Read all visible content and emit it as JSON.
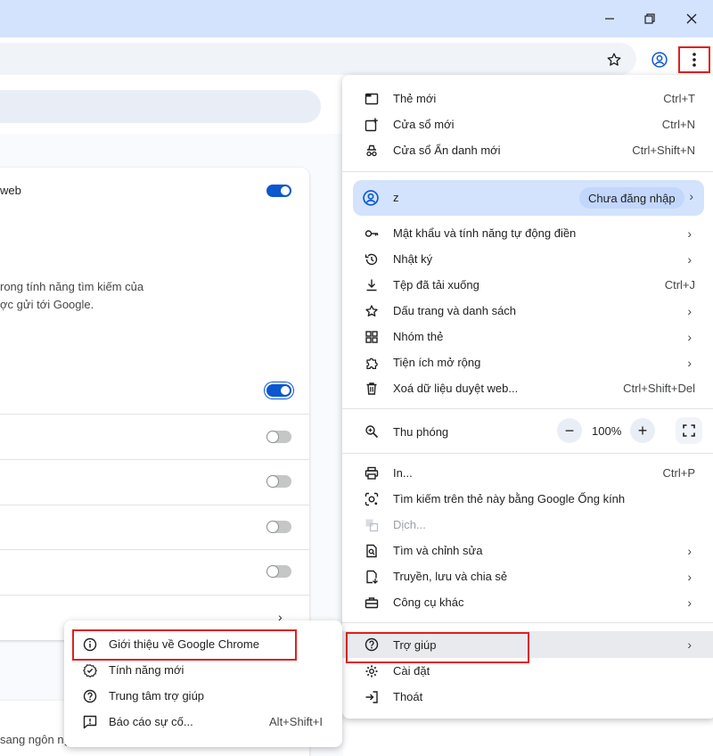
{
  "window": {
    "controls": [
      "minimize-icon",
      "restore-icon",
      "close-icon"
    ]
  },
  "toolbar": {
    "icons": [
      "star-icon",
      "profile-icon",
      "more-vert-icon"
    ]
  },
  "page": {
    "card_rows": [
      {
        "text": "web"
      },
      {
        "text": "rong tính năng tìm kiếm của\nợc gửi tới Google."
      }
    ],
    "toggles": [
      "on",
      "on",
      "off",
      "off",
      "off",
      "off"
    ],
    "bottom_text": "sang ngôn ng"
  },
  "menu": {
    "items_top": [
      {
        "icon": "new-tab-icon",
        "label": "Thẻ mới",
        "shortcut": "Ctrl+T"
      },
      {
        "icon": "new-window-icon",
        "label": "Cửa sổ mới",
        "shortcut": "Ctrl+N"
      },
      {
        "icon": "incognito-icon",
        "label": "Cửa sổ Ẩn danh mới",
        "shortcut": "Ctrl+Shift+N"
      }
    ],
    "profile": {
      "name": "z",
      "status": "Chưa đăng nhập"
    },
    "items_mid": [
      {
        "icon": "key-icon",
        "label": "Mật khẩu và tính năng tự động điền",
        "shortcut": "",
        "submenu": true
      },
      {
        "icon": "history-icon",
        "label": "Nhật ký",
        "shortcut": "",
        "submenu": true
      },
      {
        "icon": "download-icon",
        "label": "Tệp đã tải xuống",
        "shortcut": "Ctrl+J",
        "submenu": false
      },
      {
        "icon": "bookmark-star-icon",
        "label": "Dấu trang và danh sách",
        "shortcut": "",
        "submenu": true
      },
      {
        "icon": "tab-groups-icon",
        "label": "Nhóm thẻ",
        "shortcut": "",
        "submenu": true
      },
      {
        "icon": "extension-icon",
        "label": "Tiện ích mở rộng",
        "shortcut": "",
        "submenu": true
      },
      {
        "icon": "trash-icon",
        "label": "Xoá dữ liệu duyệt web...",
        "shortcut": "Ctrl+Shift+Del",
        "submenu": false
      }
    ],
    "zoom": {
      "label": "Thu phóng",
      "minus": "−",
      "value": "100%",
      "plus": "+"
    },
    "items_tools": [
      {
        "icon": "print-icon",
        "label": "In...",
        "shortcut": "Ctrl+P",
        "submenu": false,
        "disabled": false
      },
      {
        "icon": "lens-icon",
        "label": "Tìm kiếm trên thẻ này bằng Google Ống kính",
        "shortcut": "",
        "submenu": false,
        "disabled": false
      },
      {
        "icon": "translate-icon",
        "label": "Dịch...",
        "shortcut": "",
        "submenu": false,
        "disabled": true
      },
      {
        "icon": "find-edit-icon",
        "label": "Tìm và chỉnh sửa",
        "shortcut": "",
        "submenu": true,
        "disabled": false
      },
      {
        "icon": "cast-save-share-icon",
        "label": "Truyền, lưu và chia sẻ",
        "shortcut": "",
        "submenu": true,
        "disabled": false
      },
      {
        "icon": "toolbox-icon",
        "label": "Công cụ khác",
        "shortcut": "",
        "submenu": true,
        "disabled": false
      }
    ],
    "items_bottom": [
      {
        "icon": "help-icon",
        "label": "Trợ giúp",
        "submenu": true
      },
      {
        "icon": "settings-icon",
        "label": "Cài đặt",
        "submenu": false
      },
      {
        "icon": "exit-icon",
        "label": "Thoát",
        "submenu": false
      }
    ]
  },
  "help_submenu": {
    "items": [
      {
        "icon": "info-icon",
        "label": "Giới thiệu về Google Chrome",
        "shortcut": ""
      },
      {
        "icon": "new-badge-icon",
        "label": "Tính năng mới",
        "shortcut": ""
      },
      {
        "icon": "help-center-icon",
        "label": "Trung tâm trợ giúp",
        "shortcut": ""
      },
      {
        "icon": "report-icon",
        "label": "Báo cáo sự cố...",
        "shortcut": "Alt+Shift+I"
      }
    ]
  },
  "colors": {
    "accent": "#0b57d0",
    "highlight_outline": "#e02020",
    "titlebar": "#d3e3fd"
  }
}
